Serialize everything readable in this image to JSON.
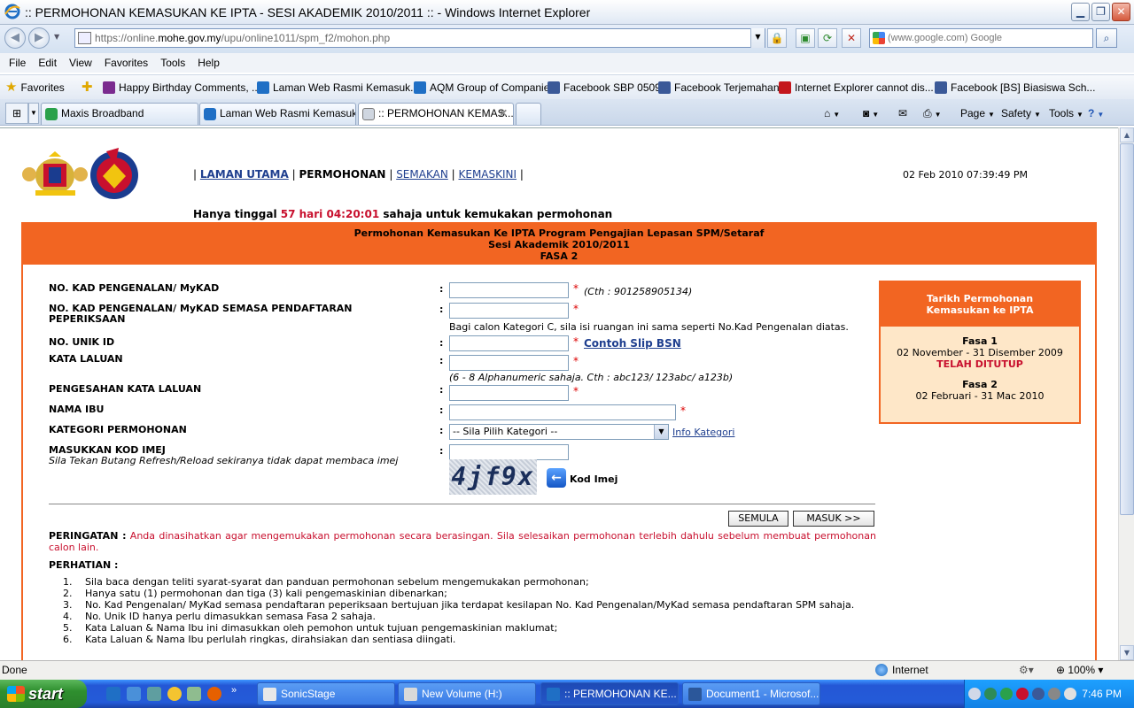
{
  "window": {
    "title": ":: PERMOHONAN KEMASUKAN KE IPTA - SESI AKADEMIK 2010/2011 :: - Windows Internet Explorer",
    "minimize": "▁",
    "maximize": "❐",
    "close": "✕"
  },
  "address": {
    "scheme": "https://online.",
    "host": "mohe.gov.my",
    "path": "/upu/online1011/spm_f2/mohon.php",
    "search_placeholder": "(www.google.com) Google"
  },
  "menu": [
    "File",
    "Edit",
    "View",
    "Favorites",
    "Tools",
    "Help"
  ],
  "favorites": {
    "label": "Favorites",
    "items": [
      {
        "label": "Happy Birthday Comments, ...",
        "icon_color": "#7b2b8f"
      },
      {
        "label": "Laman Web Rasmi Kemasuk...",
        "icon_color": "#1f6fc5"
      },
      {
        "label": "AQM Group of Companies",
        "icon_color": "#1f6fc5"
      },
      {
        "label": "Facebook  SBP 0509",
        "icon_color": "#3b5998"
      },
      {
        "label": "Facebook  Terjemahan",
        "icon_color": "#3b5998"
      },
      {
        "label": "Internet Explorer cannot dis...",
        "icon_color": "#c4161c"
      },
      {
        "label": "Facebook  [BS] Biasiswa Sch...",
        "icon_color": "#3b5998"
      }
    ]
  },
  "tabs": [
    {
      "label": "Maxis Broadband",
      "icon_color": "#2aa14b"
    },
    {
      "label": "Laman Web Rasmi Kemasuka...",
      "icon_color": "#1f6fc5"
    },
    {
      "label": ":: PERMOHONAN KEMAS...",
      "icon_color": "#777777",
      "active": true
    }
  ],
  "commands": {
    "page": "Page",
    "safety": "Safety",
    "tools": "Tools"
  },
  "page": {
    "nav": {
      "home": "LAMAN UTAMA",
      "apply": "PERMOHONAN",
      "check": "SEMAKAN",
      "update": "KEMASKINI",
      "sep": "|"
    },
    "datetime": "02 Feb 2010 07:39:49 PM",
    "countdown": {
      "before": "Hanya tinggal ",
      "time": "57 hari 04:20:01",
      "after": " sahaja untuk kemukakan permohonan"
    },
    "form_header": {
      "line1": "Permohonan Kemasukan Ke IPTA Program Pengajian Lepasan SPM/Setaraf",
      "line2": "Sesi Akademik 2010/2011",
      "line3": "FASA 2"
    },
    "fields": {
      "ic": {
        "label": "NO. KAD PENGENALAN/ MyKAD",
        "hint": "(Cth : 901258905134)"
      },
      "ic_exam": {
        "label": "NO. KAD PENGENALAN/ MyKAD SEMASA PENDAFTARAN PEPERIKSAAN",
        "hint": "Bagi calon Kategori C, sila isi ruangan ini sama seperti No.Kad Pengenalan diatas."
      },
      "unique_id": {
        "label": "NO. UNIK ID",
        "link": "Contoh Slip BSN"
      },
      "password": {
        "label": "KATA LALUAN",
        "hint": "(6 - 8 Alphanumeric sahaja. Cth : abc123/ 123abc/ a123b)"
      },
      "password_confirm": {
        "label": "PENGESAHAN KATA LALUAN"
      },
      "mother_name": {
        "label": "NAMA IBU"
      },
      "category": {
        "label": "KATEGORI PERMOHONAN",
        "selected": "-- Sila Pilih Kategori --",
        "link": "Info Kategori"
      },
      "captcha": {
        "label": "MASUKKAN KOD IMEJ",
        "sublabel": "Sila Tekan Butang Refresh/Reload sekiranya tidak dapat membaca imej",
        "image_text": "4jf9x",
        "refresh_label": "Kod Imej"
      }
    },
    "colon": ":",
    "required": "*",
    "buttons": {
      "reset": "SEMULA",
      "submit": "MASUK >>"
    },
    "warning": {
      "title": "PERINGATAN :",
      "text": " Anda dinasihatkan agar mengemukakan permohonan secara berasingan. Sila selesaikan permohonan terlebih dahulu sebelum membuat permohonan calon lain."
    },
    "notice_title": "PERHATIAN :",
    "notes": [
      {
        "n": "1.",
        "text": "Sila baca dengan teliti syarat-syarat dan panduan permohonan sebelum mengemukakan permohonan;"
      },
      {
        "n": "2.",
        "text": "Hanya satu (1) permohonan dan tiga (3) kali pengemaskinian dibenarkan;"
      },
      {
        "n": "3.",
        "text": "No. Kad Pengenalan/ MyKad semasa pendaftaran peperiksaan bertujuan jika terdapat kesilapan No. Kad Pengenalan/MyKad semasa pendaftaran SPM sahaja."
      },
      {
        "n": "4.",
        "text": "No. Unik ID hanya perlu dimasukkan semasa Fasa 2 sahaja."
      },
      {
        "n": "5.",
        "text": "Kata Laluan & Nama Ibu ini dimasukkan oleh pemohon untuk tujuan pengemaskinian maklumat;"
      },
      {
        "n": "6.",
        "text": "Kata Laluan & Nama Ibu perlulah ringkas, dirahsiakan dan sentiasa diingati."
      }
    ],
    "sidebox": {
      "title1": "Tarikh Permohonan",
      "title2": "Kemasukan ke IPTA",
      "fasa1": "Fasa 1",
      "fasa1_dates": "02 November - 31 Disember 2009",
      "fasa1_status": "TELAH DITUTUP",
      "fasa2": "Fasa 2",
      "fasa2_dates": "02 Februari - 31 Mac 2010"
    }
  },
  "status": {
    "text": "Done",
    "zone": "Internet",
    "zoom": "100%"
  },
  "taskbar": {
    "start": "start",
    "tasks": [
      {
        "label": "SonicStage",
        "icon_color": "#e8e8e8"
      },
      {
        "label": "New Volume (H:)",
        "icon_color": "#d9d9d9"
      },
      {
        "label": ":: PERMOHONAN KE...",
        "icon_color": "#1f6fc5",
        "active": true
      },
      {
        "label": "Document1 - Microsof...",
        "icon_color": "#2b579a"
      }
    ],
    "clock": "7:46 PM"
  },
  "colors": {
    "accent_orange": "#f26522",
    "link_blue": "#1f3f8f",
    "alert_red": "#c8102e",
    "sidebox_bg": "#fee7c8"
  }
}
